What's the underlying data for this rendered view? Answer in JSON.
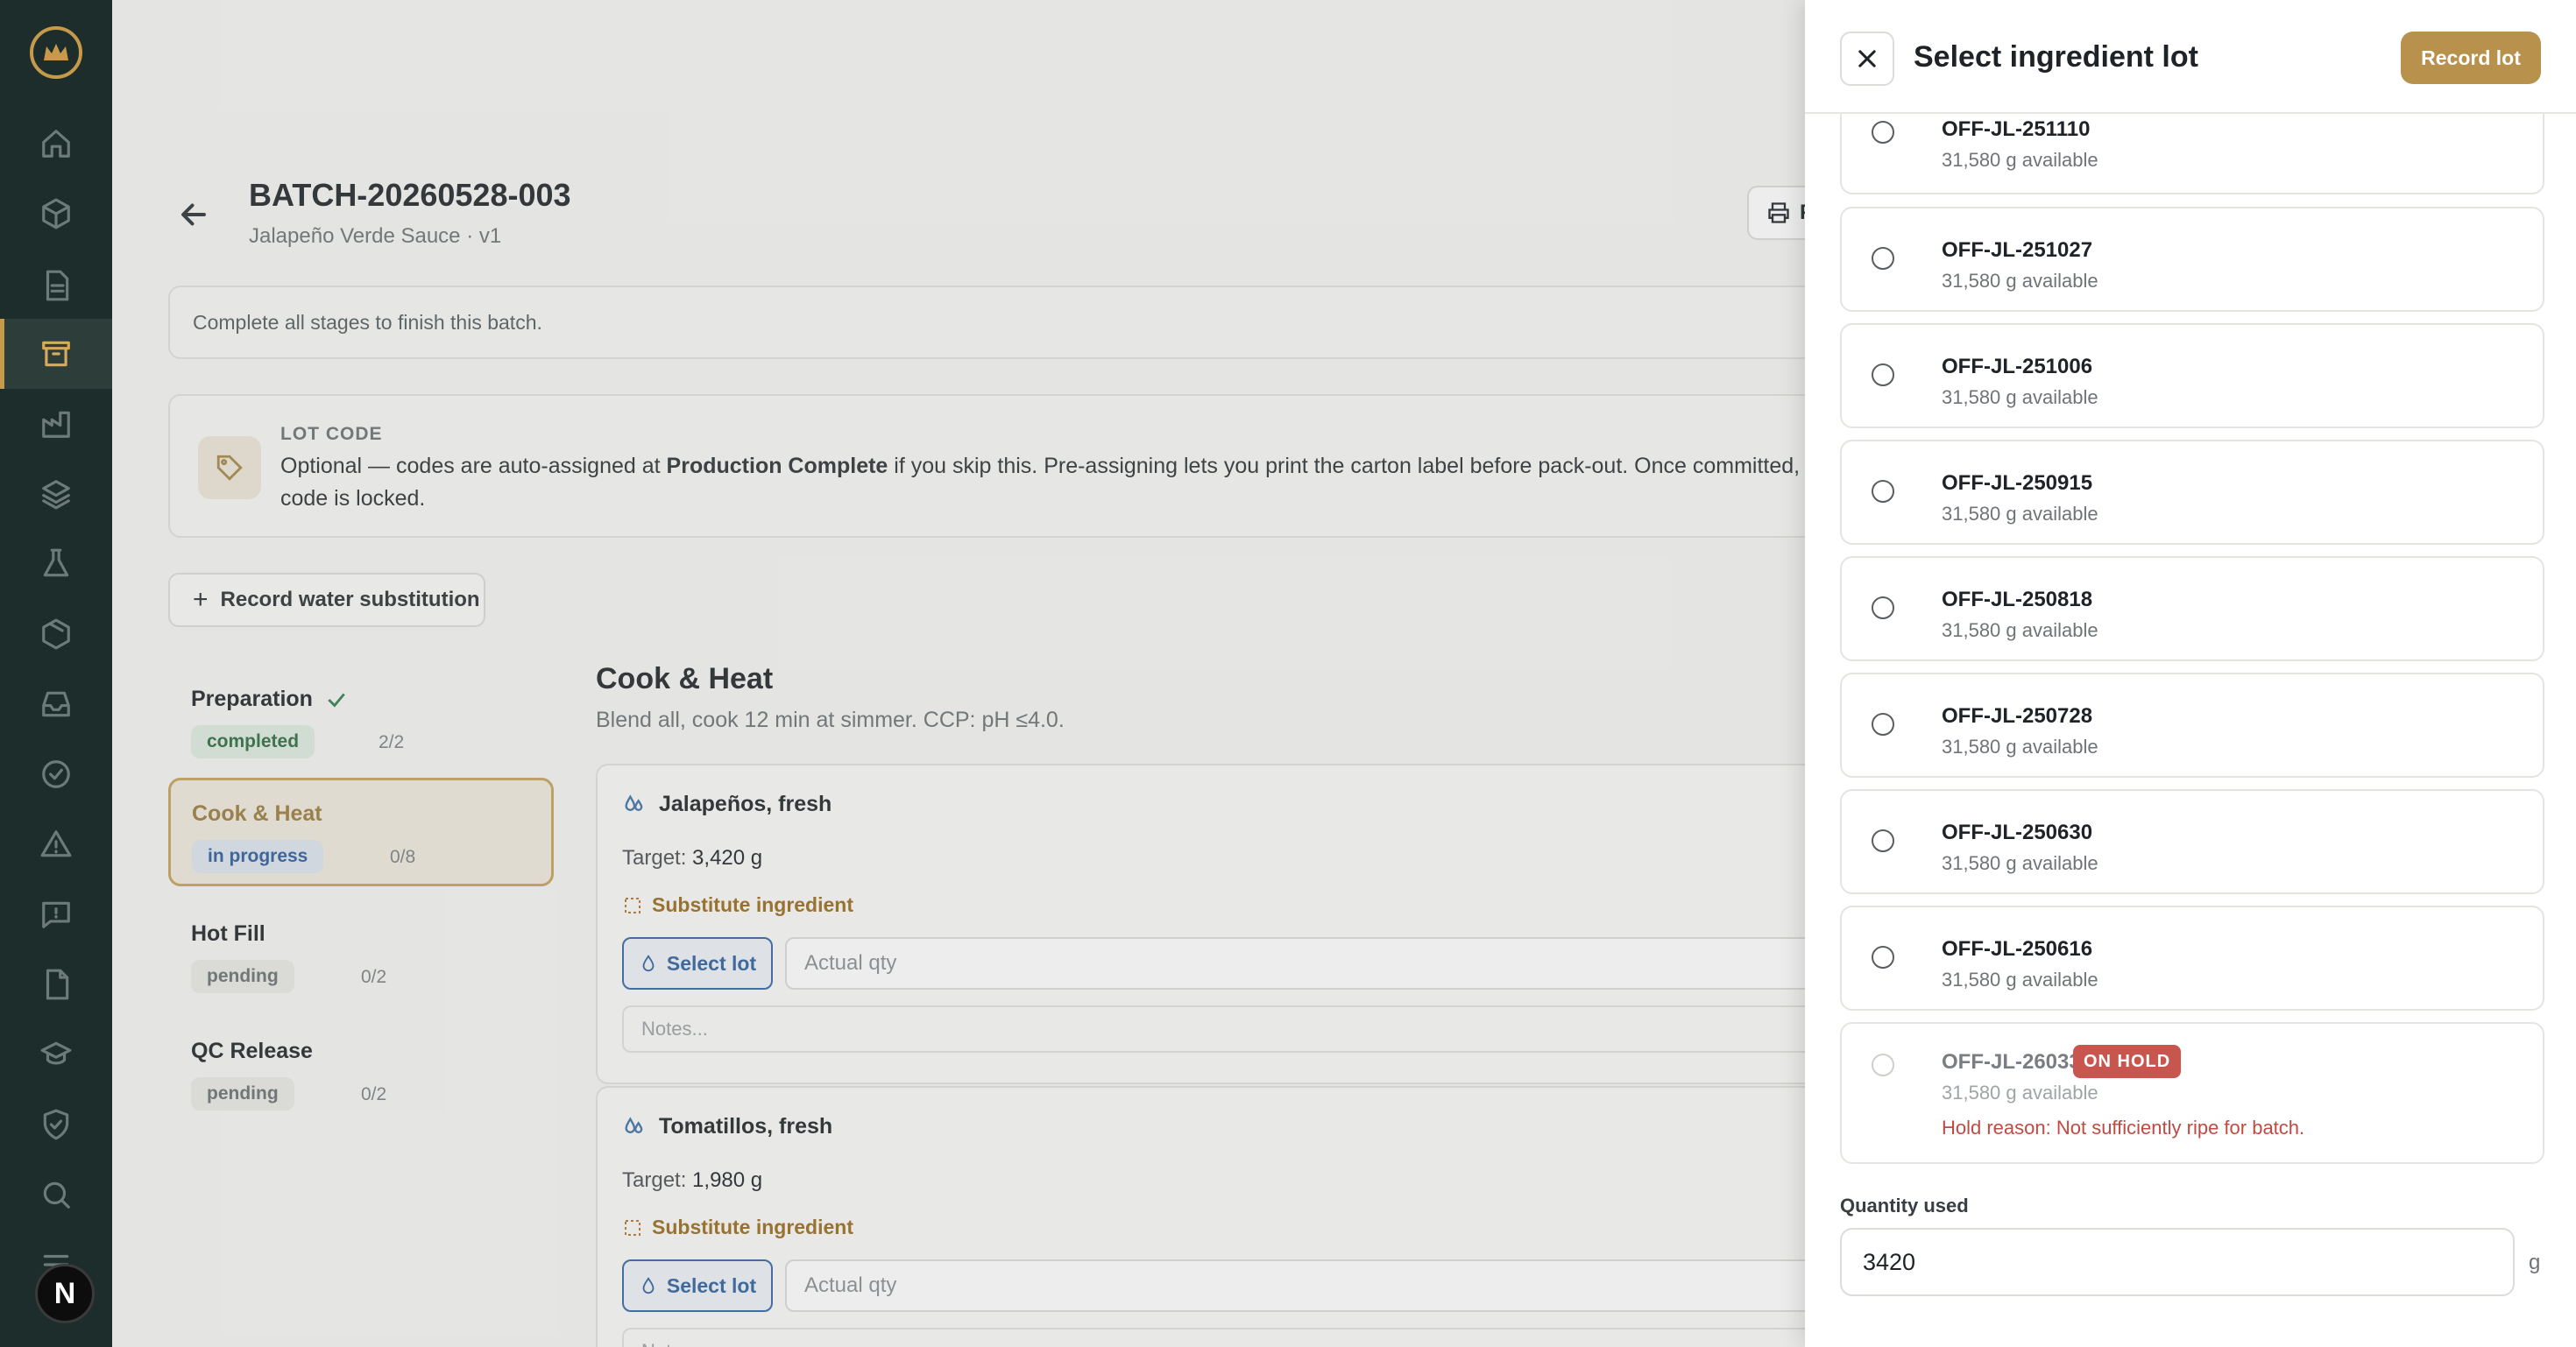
{
  "sidebar": {
    "items": [
      "home",
      "products",
      "documents",
      "batches",
      "production",
      "layers",
      "lab",
      "packaging",
      "inbox",
      "checks",
      "alerts",
      "messages",
      "files",
      "training",
      "security",
      "search",
      "more"
    ],
    "avatar_initial": "N"
  },
  "batch": {
    "title": "BATCH-20260528-003",
    "subtitle": "Jalapeño Verde Sauce · v1",
    "print_label": "P"
  },
  "notice": "Complete all stages to finish this batch.",
  "lot_code": {
    "label": "LOT CODE",
    "text_before": "Optional — codes are auto-assigned at ",
    "text_bold": "Production Complete",
    "text_after": " if you skip this. Pre-assigning lets you print the carton label before pack-out. Once committed, the code is locked."
  },
  "water_button": "Record water substitution",
  "stages": [
    {
      "name": "Preparation",
      "status": "completed",
      "count": "2/2"
    },
    {
      "name": "Cook & Heat",
      "status": "in progress",
      "count": "0/8"
    },
    {
      "name": "Hot Fill",
      "status": "pending",
      "count": "0/2"
    },
    {
      "name": "QC Release",
      "status": "pending",
      "count": "0/2"
    }
  ],
  "section": {
    "title": "Cook & Heat",
    "subtitle": "Blend all, cook 12 min at simmer. CCP: pH ≤4.0."
  },
  "ingredients": [
    {
      "name": "Jalapeños, fresh",
      "target_label": "Target: ",
      "target": "3,420 g",
      "substitute": "Substitute ingredient",
      "select_lot": "Select lot",
      "qty_placeholder": "Actual qty",
      "notes_placeholder": "Notes..."
    },
    {
      "name": "Tomatillos, fresh",
      "target_label": "Target: ",
      "target": "1,980 g",
      "substitute": "Substitute ingredient",
      "select_lot": "Select lot",
      "qty_placeholder": "Actual qty",
      "notes_placeholder": "Notes..."
    }
  ],
  "drawer": {
    "title": "Select ingredient lot",
    "record_button": "Record lot",
    "lots": [
      {
        "id": "OFF-JL-251110",
        "available": "31,580 g available"
      },
      {
        "id": "OFF-JL-251027",
        "available": "31,580 g available"
      },
      {
        "id": "OFF-JL-251006",
        "available": "31,580 g available"
      },
      {
        "id": "OFF-JL-250915",
        "available": "31,580 g available"
      },
      {
        "id": "OFF-JL-250818",
        "available": "31,580 g available"
      },
      {
        "id": "OFF-JL-250728",
        "available": "31,580 g available"
      },
      {
        "id": "OFF-JL-250630",
        "available": "31,580 g available"
      },
      {
        "id": "OFF-JL-250616",
        "available": "31,580 g available"
      }
    ],
    "hold_lot": {
      "id": "OFF-JL-260330",
      "badge": "ON HOLD",
      "available": "31,580 g available",
      "reason": "Hold reason: Not sufficiently ripe for batch."
    },
    "quantity_label": "Quantity used",
    "quantity_value": "3420",
    "quantity_unit": "g"
  },
  "colors": {
    "sidebar_bg": "#1d2d2b",
    "accent_gold": "#b8914d",
    "link_blue": "#2e5e9e",
    "hold_red": "#c8564e"
  }
}
